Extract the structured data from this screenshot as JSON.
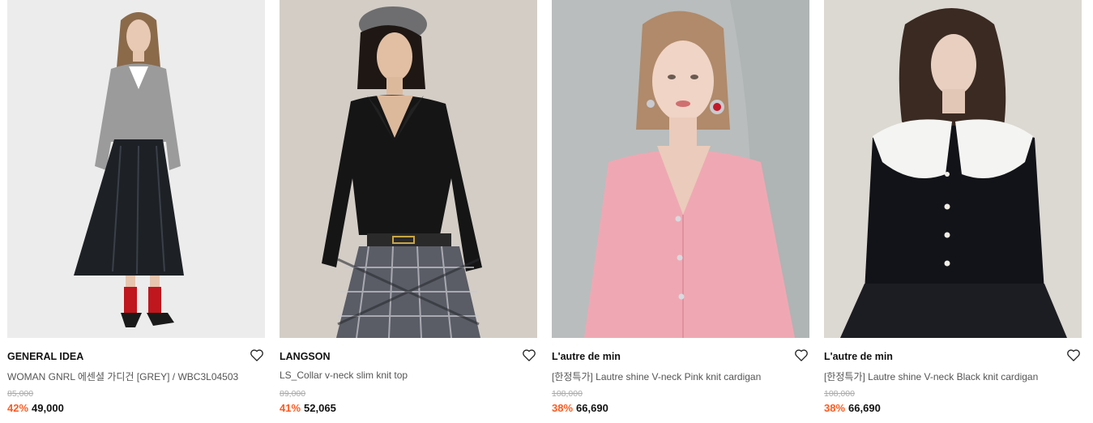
{
  "products": [
    {
      "brand": "GENERAL IDEA",
      "name": "WOMAN GNRL 에센셜 가디건 [GREY] / WBC3L04503",
      "original_price": "85,000",
      "discount": "42%",
      "sale_price": "49,000",
      "wishlist_icon": "heart-outline-icon",
      "image_desc_colors": {
        "bg": "#ececec",
        "top": "#9b9b9b",
        "skirt": "#1d2126",
        "socks": "#c0161d"
      }
    },
    {
      "brand": "LANGSON",
      "name": "LS_Collar v-neck slim knit top",
      "original_price": "89,000",
      "discount": "41%",
      "sale_price": "52,065",
      "wishlist_icon": "heart-outline-icon",
      "image_desc_colors": {
        "bg": "#cfc9c2",
        "top": "#151515",
        "skirt": "#5a5c66",
        "beret": "#6e6e70"
      }
    },
    {
      "brand": "L'autre de min",
      "name": "[한정특가] Lautre shine V-neck Pink knit cardigan",
      "original_price": "108,000",
      "discount": "38%",
      "sale_price": "66,690",
      "wishlist_icon": "heart-outline-icon",
      "image_desc_colors": {
        "bg": "#b9bdbd",
        "top": "#efa8b3",
        "hair": "#b08a6a"
      }
    },
    {
      "brand": "L'autre de min",
      "name": "[한정특가] Lautre shine V-neck Black knit cardigan",
      "original_price": "108,000",
      "discount": "38%",
      "sale_price": "66,690",
      "wishlist_icon": "heart-outline-icon",
      "image_desc_colors": {
        "bg": "#dcd8d2",
        "top": "#111318",
        "collar": "#f4f4f2",
        "hair": "#3a2a22"
      }
    }
  ],
  "colors": {
    "discount": "#ff5a1f",
    "strike": "#aaaaaa",
    "text": "#111111",
    "name": "#555555"
  }
}
